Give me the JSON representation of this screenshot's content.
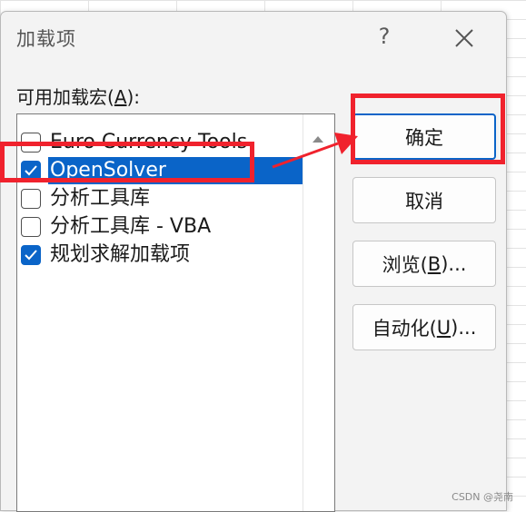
{
  "dialog": {
    "title": "加载项",
    "help_label": "?",
    "close_label": "Close"
  },
  "list": {
    "caption_prefix": "可用加载宏(",
    "caption_hotkey": "A",
    "caption_suffix": "):",
    "items": [
      {
        "label": "Euro Currency Tools",
        "checked": false,
        "selected": false
      },
      {
        "label": "OpenSolver",
        "checked": true,
        "selected": true
      },
      {
        "label": "分析工具库",
        "checked": false,
        "selected": false
      },
      {
        "label": "分析工具库 - VBA",
        "checked": false,
        "selected": false
      },
      {
        "label": "规划求解加载项",
        "checked": true,
        "selected": false
      }
    ]
  },
  "buttons": {
    "ok": {
      "label": "确定"
    },
    "cancel": {
      "label": "取消"
    },
    "browse": {
      "prefix": "浏览(",
      "hotkey": "B",
      "suffix": ")..."
    },
    "automation": {
      "prefix": "自动化(",
      "hotkey": "U",
      "suffix": ")..."
    }
  },
  "watermark": "CSDN @尧南",
  "colors": {
    "accent": "#0a64c8",
    "annotation": "#f0222d"
  }
}
